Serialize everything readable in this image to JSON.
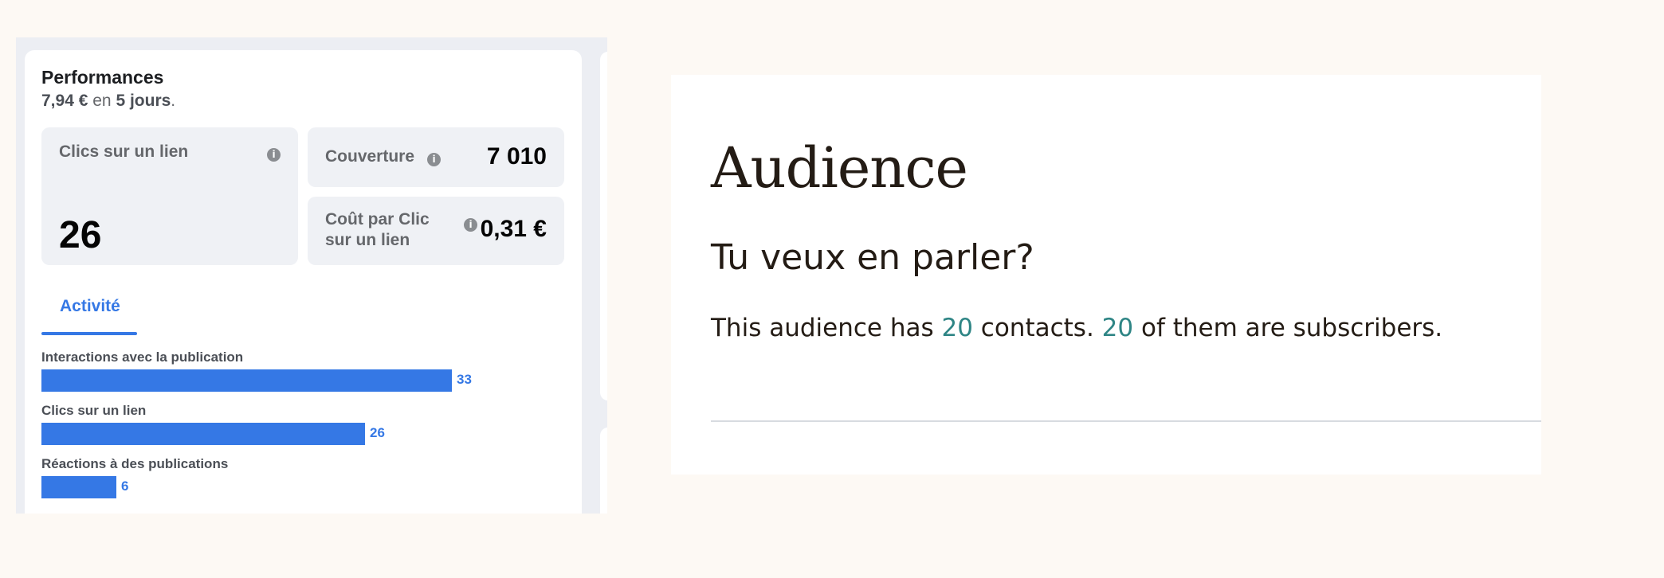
{
  "performance": {
    "title": "Performances",
    "spent": "7,94 €",
    "in_word": "en",
    "duration": "5 jours",
    "period_suffix": ".",
    "metrics": {
      "link_clicks": {
        "label": "Clics sur un lien",
        "value": "26"
      },
      "reach": {
        "label": "Couverture",
        "value": "7 010"
      },
      "cpc": {
        "label_line1": "Coût par Clic",
        "label_line2": "sur un lien",
        "value": "0,31 €"
      }
    },
    "info_icon_glyph": "i",
    "tab": {
      "label": "Activité"
    },
    "bars": [
      {
        "label": "Interactions avec la publication",
        "value": 33,
        "display": "33"
      },
      {
        "label": "Clics sur un lien",
        "value": 26,
        "display": "26"
      },
      {
        "label": "Réactions à des publications",
        "value": 6,
        "display": "6"
      }
    ],
    "bar_color": "#3578e5"
  },
  "audience": {
    "title": "Audience",
    "subtitle": "Tu veux en parler?",
    "text_before": "This audience has ",
    "contacts": "20",
    "text_middle": " contacts. ",
    "subscribers": "20",
    "text_after": " of them are subscribers.",
    "accent_color": "#2e8585"
  }
}
